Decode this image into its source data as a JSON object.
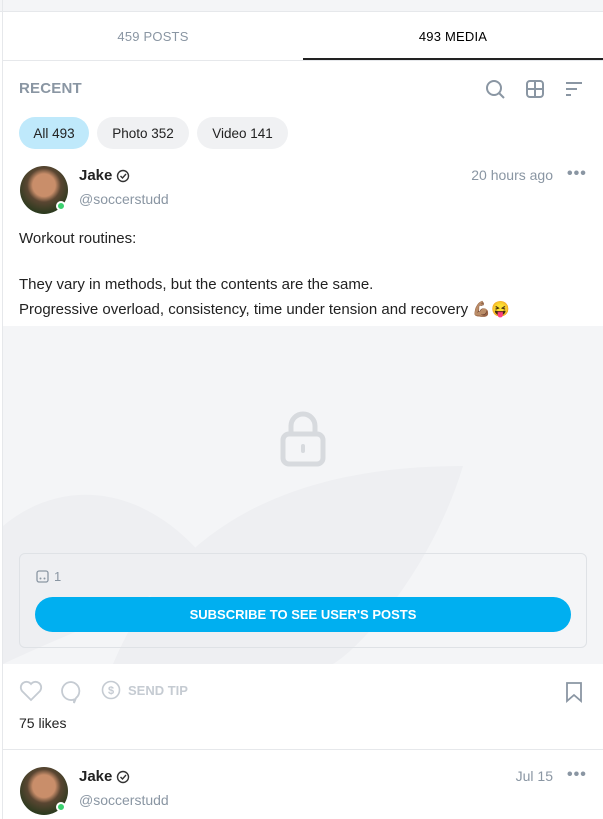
{
  "tabs": [
    {
      "label": "459 POSTS",
      "active": false
    },
    {
      "label": "493 MEDIA",
      "active": true
    }
  ],
  "section_title": "RECENT",
  "toolbar_icons": [
    "search-icon",
    "grid-icon",
    "sort-icon"
  ],
  "filters": [
    {
      "label": "All 493",
      "active": true
    },
    {
      "label": "Photo 352",
      "active": false
    },
    {
      "label": "Video 141",
      "active": false
    }
  ],
  "posts": [
    {
      "name": "Jake",
      "handle": "@soccerstudd",
      "time": "20 hours ago",
      "text_lines": [
        "Workout routines:",
        "They vary in methods, but the contents are the same.",
        "Progressive overload, consistency, time under tension and recovery 💪🏽😝"
      ],
      "media_count": "1",
      "subscribe_label": "SUBSCRIBE TO SEE USER'S POSTS",
      "send_tip": "SEND TIP",
      "likes": "75 likes"
    },
    {
      "name": "Jake",
      "handle": "@soccerstudd",
      "time": "Jul 15"
    }
  ],
  "colors": {
    "accent": "#00aff0",
    "chip_active": "#bfe9fb",
    "online": "#3bd16f"
  }
}
